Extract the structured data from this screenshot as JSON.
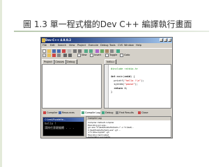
{
  "slide": {
    "title": "圖 1.3 單一程式檔的Dev C++ 編譯執行畫面"
  },
  "window": {
    "title": "Dev-C++ 4.9.9.2",
    "menu": [
      "File",
      "Edit",
      "Search",
      "View",
      "Project",
      "Execute",
      "Debug",
      "Tools",
      "CVS",
      "Window",
      "Help"
    ],
    "toolbar2": {
      "new_label": "New",
      "insert_label": "Insert",
      "toggle_label": "Toggle",
      "goto_label": "Goto"
    },
    "left_tabs": [
      "Project",
      "Classes",
      "Debug"
    ],
    "editor_tab": "hello.c",
    "code_lines": [
      {
        "tokens": [
          {
            "t": "#include <stdio.h>",
            "c": "pp"
          }
        ]
      },
      {
        "tokens": [
          {
            "t": "",
            "c": ""
          }
        ]
      },
      {
        "tokens": [
          {
            "t": "int",
            "c": "kw"
          },
          {
            "t": " main(",
            "c": ""
          },
          {
            "t": "void",
            "c": "kw"
          },
          {
            "t": ") {",
            "c": ""
          }
        ]
      },
      {
        "tokens": [
          {
            "t": "  printf(",
            "c": ""
          },
          {
            "t": "\"hello !\\n\"",
            "c": "str"
          },
          {
            "t": ");",
            "c": ""
          }
        ]
      },
      {
        "tokens": [
          {
            "t": "  system(",
            "c": ""
          },
          {
            "t": "\"pause\"",
            "c": "str"
          },
          {
            "t": ");",
            "c": ""
          }
        ]
      },
      {
        "tokens": [
          {
            "t": "  ",
            "c": ""
          },
          {
            "t": "return",
            "c": "kw"
          },
          {
            "t": " 0;",
            "c": ""
          }
        ]
      },
      {
        "tokens": [
          {
            "t": "}",
            "c": ""
          }
        ]
      }
    ],
    "bottom_tabs": [
      "Compiler",
      "Resources",
      "Compile Log",
      "Debug",
      "Find Results",
      "Close"
    ],
    "console": {
      "title": "C:\\test\\PuzzleHe...",
      "lines": [
        "hello !",
        "請按任意鍵繼續 . . ."
      ]
    },
    "compile_log": {
      "header": "Compile Log",
      "lines": [
        "Compiler: Default compiler",
        "Executing  gcc.exe...",
        "gcc.exe \"C:\\test\\PuzzleHe\\hello.c\" -o \"C:\\test\\...",
        "C:\\test\\PuzzleHe\\hello.exe\"  -g3 ...",
        "-L\"C:\\Dev-Cpp\\lib\"  -g3",
        "Execution terminated",
        "Compilation successful"
      ]
    }
  },
  "colors": {
    "titlebar_start": "#0a246a",
    "titlebar_end": "#a6caf0",
    "window_bg": "#d4d0c8",
    "string_color": "#cc0000",
    "preprocessor_color": "#1b8f1b"
  }
}
